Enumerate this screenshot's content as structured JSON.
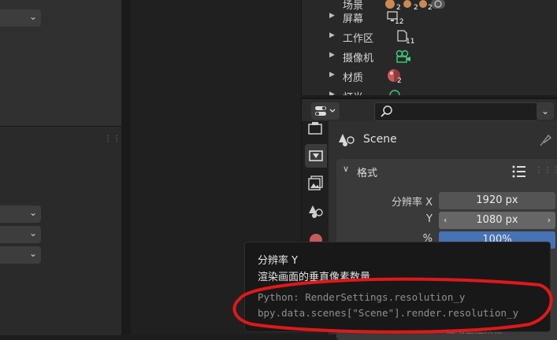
{
  "outliner": {
    "items": [
      {
        "label": "场景",
        "count": "2"
      },
      {
        "label": "屏幕",
        "count": "12"
      },
      {
        "label": "工作区",
        "count": "11"
      },
      {
        "label": "摄像机",
        "count": ""
      },
      {
        "label": "材质",
        "count": "2"
      },
      {
        "label": "灯光",
        "count": ""
      }
    ],
    "scene_row_counts": [
      "2",
      "2",
      "2"
    ]
  },
  "properties": {
    "scene_name": "Scene",
    "panel_title": "格式",
    "resolution_x_label": "分辨率 X",
    "resolution_x_value": "1920 px",
    "resolution_y_label": "Y",
    "resolution_y_value": "1080 px",
    "percent_label": "%",
    "percent_value": "100%"
  },
  "tooltip": {
    "title": "分辨率 Y",
    "description": "渲染画面的垂直像素数量.",
    "python_1": "Python: RenderSettings.resolution_y",
    "python_2": "bpy.data.scenes[\"Scene\"].render.resolution_y"
  },
  "obscured_text": "截动至渲染框",
  "colors": {
    "accent_blue": "#4772b3",
    "annotation_red": "#e01818",
    "camera_green": "#3fcf7a"
  }
}
